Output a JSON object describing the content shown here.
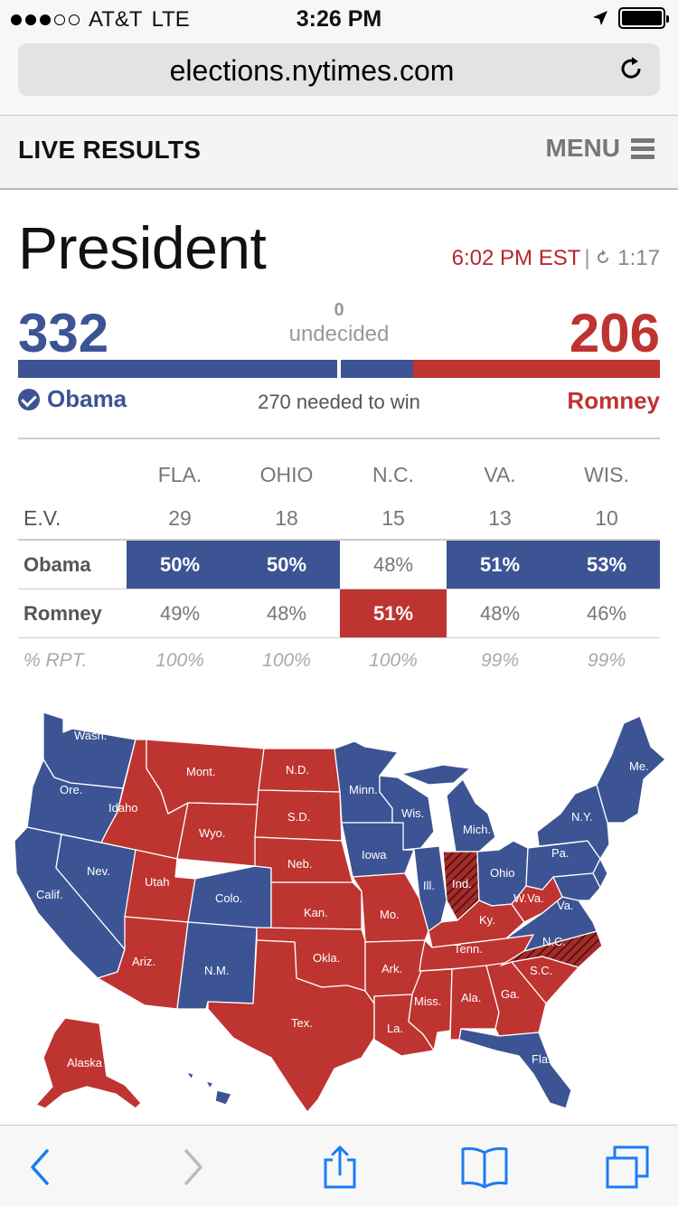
{
  "status_bar": {
    "carrier": "AT&T",
    "network": "LTE",
    "time": "3:26 PM"
  },
  "browser": {
    "url": "elections.nytimes.com"
  },
  "header": {
    "title": "LIVE RESULTS",
    "menu_label": "MENU"
  },
  "race": {
    "title": "President",
    "updated_time": "6:02 PM EST",
    "refresh_countdown": "1:17",
    "obama_ev": "332",
    "romney_ev": "206",
    "undecided_count": "0",
    "undecided_label": "undecided",
    "obama_name": "Obama",
    "romney_name": "Romney",
    "needed_label": "270 needed to win",
    "bar": {
      "obama_fraction": 0.5,
      "undecided_fraction": 0.115,
      "romney_fraction": 0.385
    },
    "colors": {
      "dem": "#3c5494",
      "rep": "#be3431"
    }
  },
  "battleground": {
    "ev_label": "E.V.",
    "rpt_label": "% RPT.",
    "states": [
      {
        "abbr": "FLA.",
        "ev": "29",
        "obama": "50%",
        "romney": "49%",
        "rpt": "100%",
        "winner": "obama"
      },
      {
        "abbr": "OHIO",
        "ev": "18",
        "obama": "50%",
        "romney": "48%",
        "rpt": "100%",
        "winner": "obama"
      },
      {
        "abbr": "N.C.",
        "ev": "15",
        "obama": "48%",
        "romney": "51%",
        "rpt": "100%",
        "winner": "romney"
      },
      {
        "abbr": "VA.",
        "ev": "13",
        "obama": "51%",
        "romney": "48%",
        "rpt": "99%",
        "winner": "obama"
      },
      {
        "abbr": "WIS.",
        "ev": "10",
        "obama": "53%",
        "romney": "46%",
        "rpt": "99%",
        "winner": "obama"
      }
    ]
  },
  "map": {
    "labels": {
      "wash": "Wash.",
      "ore": "Ore.",
      "calif": "Calif.",
      "nev": "Nev.",
      "idaho": "Idaho",
      "mont": "Mont.",
      "wyo": "Wyo.",
      "utah": "Utah",
      "ariz": "Ariz.",
      "colo": "Colo.",
      "nm": "N.M.",
      "nd": "N.D.",
      "sd": "S.D.",
      "neb": "Neb.",
      "kan": "Kan.",
      "okla": "Okla.",
      "tex": "Tex.",
      "minn": "Minn.",
      "iowa": "Iowa",
      "mo": "Mo.",
      "ark": "Ark.",
      "la": "La.",
      "wis": "Wis.",
      "ill": "Ill.",
      "mich": "Mich.",
      "ind": "Ind.",
      "ohio": "Ohio",
      "ky": "Ky.",
      "tenn": "Tenn.",
      "miss": "Miss.",
      "ala": "Ala.",
      "ga": "Ga.",
      "fla": "Fla.",
      "sc": "S.C.",
      "nc": "N.C.",
      "va": "Va.",
      "wva": "W.Va.",
      "pa": "Pa.",
      "ny": "N.Y.",
      "me": "Me.",
      "alaska": "Alaska"
    }
  }
}
